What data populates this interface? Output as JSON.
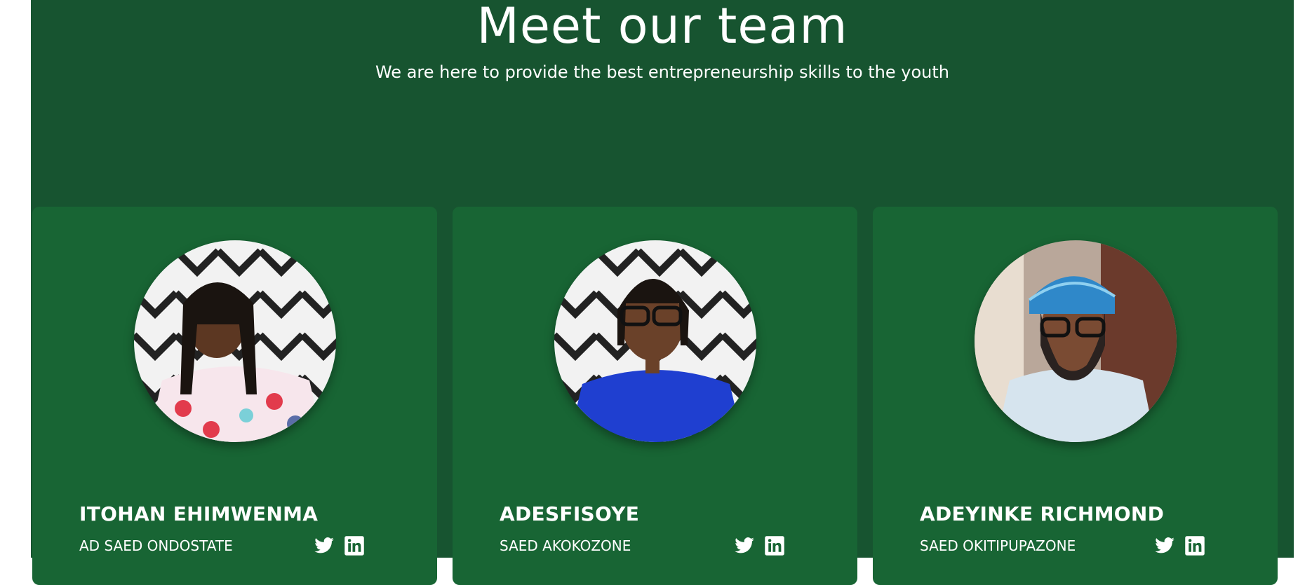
{
  "team": {
    "title": "Meet our team",
    "subtitle": "We are here to provide the best entrepreneurship skills to the youth",
    "members": [
      {
        "name": "ITOHAN EHIMWENMA",
        "role": "AD SAED ONDOSTATE",
        "photo": "portrait-woman-polka-dot-dress",
        "social": [
          "twitter-icon",
          "linkedin-icon"
        ]
      },
      {
        "name": "ADESFISOYE",
        "role": "SAED AKOKOZONE",
        "photo": "portrait-woman-blue-top-glasses",
        "social": [
          "twitter-icon",
          "linkedin-icon"
        ]
      },
      {
        "name": "ADEYINKE RICHMOND",
        "role": "SAED OKITIPUPAZONE",
        "photo": "portrait-man-blue-cap-glasses",
        "social": [
          "twitter-icon",
          "linkedin-icon"
        ]
      }
    ]
  },
  "colors": {
    "section_bg": "#175430",
    "card_bg": "#186534",
    "text": "#ffffff"
  }
}
